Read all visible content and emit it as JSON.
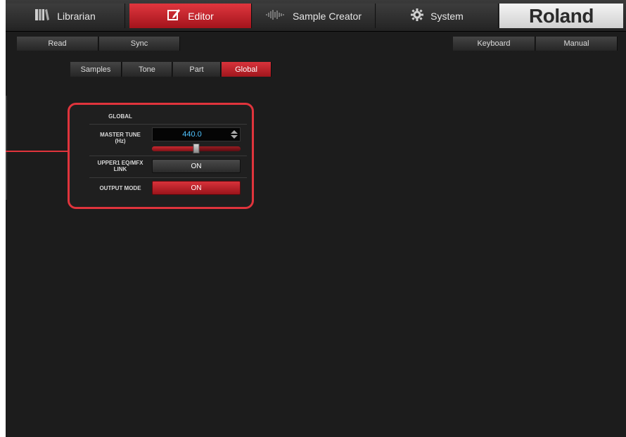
{
  "nav": {
    "tabs": [
      {
        "label": "Librarian",
        "icon": "books-icon"
      },
      {
        "label": "Editor",
        "icon": "edit-icon",
        "active": true
      },
      {
        "label": "Sample Creator",
        "icon": "waveform-icon"
      },
      {
        "label": "System",
        "icon": "gear-icon"
      }
    ],
    "brand": "Roland"
  },
  "toolbar": {
    "read": "Read",
    "sync": "Sync",
    "keyboard": "Keyboard",
    "manual": "Manual"
  },
  "subtabs": [
    {
      "label": "Samples"
    },
    {
      "label": "Tone"
    },
    {
      "label": "Part"
    },
    {
      "label": "Global",
      "active": true
    }
  ],
  "global_panel": {
    "title": "GLOBAL",
    "master_tune": {
      "label_line1": "MASTER TUNE",
      "label_line2": "(Hz)",
      "value": "440.0",
      "slider_fraction": 0.5
    },
    "upper1_link": {
      "label_line1": "UPPER1 EQ/MFX",
      "label_line2": "LINK",
      "value": "ON"
    },
    "output_mode": {
      "label": "OUTPUT MODE",
      "value": "ON"
    }
  },
  "colors": {
    "accent_red": "#d8323a",
    "value_blue": "#4fc3ff"
  }
}
